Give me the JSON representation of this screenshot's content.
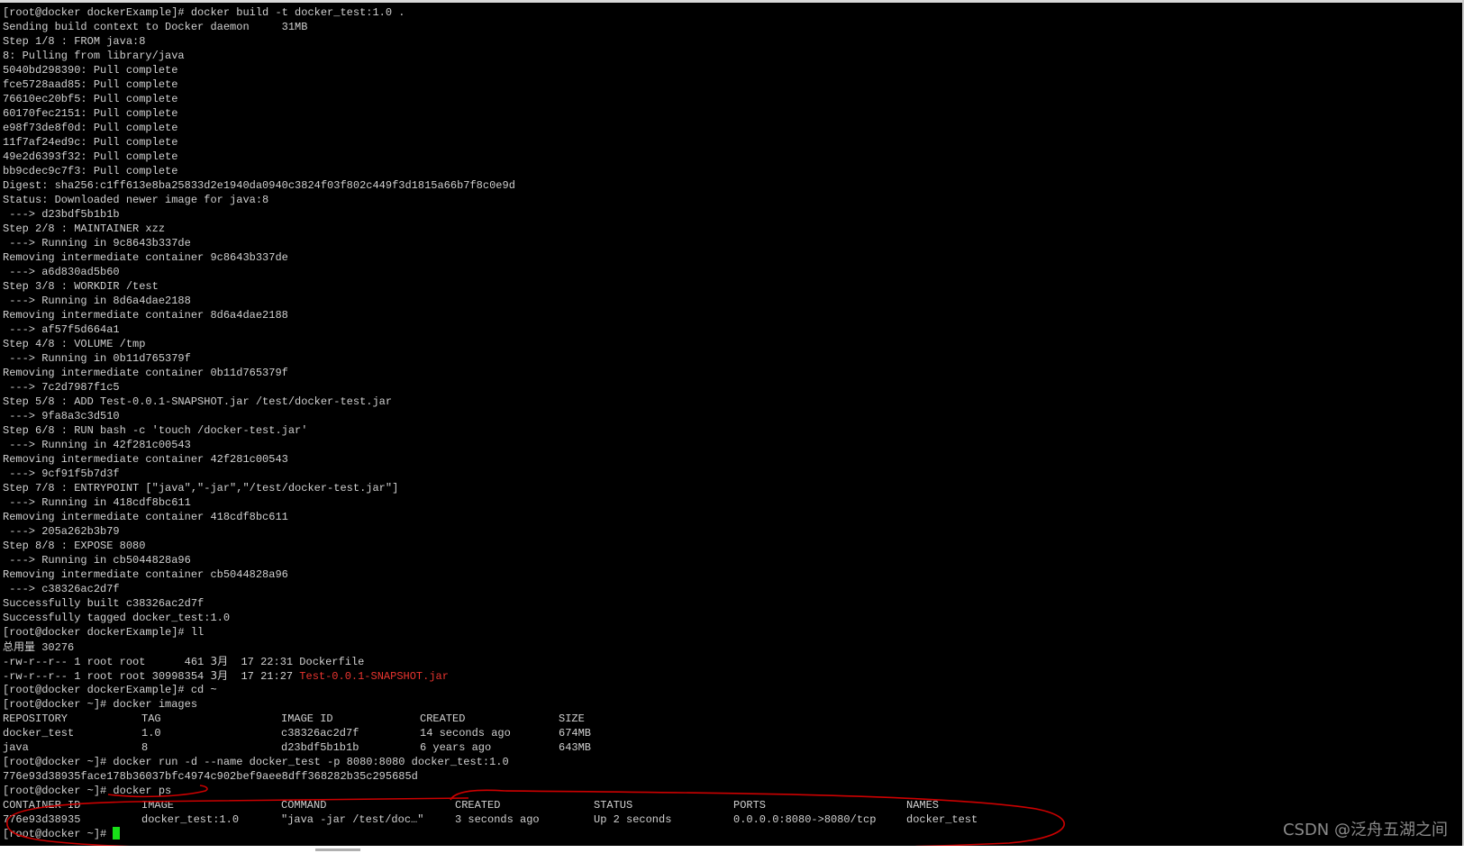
{
  "build": [
    "[root@docker dockerExample]# docker build -t docker_test:1.0 .",
    "Sending build context to Docker daemon     31MB",
    "Step 1/8 : FROM java:8",
    "8: Pulling from library/java",
    "5040bd298390: Pull complete",
    "fce5728aad85: Pull complete",
    "76610ec20bf5: Pull complete",
    "60170fec2151: Pull complete",
    "e98f73de8f0d: Pull complete",
    "11f7af24ed9c: Pull complete",
    "49e2d6393f32: Pull complete",
    "bb9cdec9c7f3: Pull complete",
    "Digest: sha256:c1ff613e8ba25833d2e1940da0940c3824f03f802c449f3d1815a66b7f8c0e9d",
    "Status: Downloaded newer image for java:8",
    " ---> d23bdf5b1b1b",
    "Step 2/8 : MAINTAINER xzz",
    " ---> Running in 9c8643b337de",
    "Removing intermediate container 9c8643b337de",
    " ---> a6d830ad5b60",
    "Step 3/8 : WORKDIR /test",
    " ---> Running in 8d6a4dae2188",
    "Removing intermediate container 8d6a4dae2188",
    " ---> af57f5d664a1",
    "Step 4/8 : VOLUME /tmp",
    " ---> Running in 0b11d765379f",
    "Removing intermediate container 0b11d765379f",
    " ---> 7c2d7987f1c5",
    "Step 5/8 : ADD Test-0.0.1-SNAPSHOT.jar /test/docker-test.jar",
    " ---> 9fa8a3c3d510",
    "Step 6/8 : RUN bash -c 'touch /docker-test.jar'",
    " ---> Running in 42f281c00543",
    "Removing intermediate container 42f281c00543",
    " ---> 9cf91f5b7d3f",
    "Step 7/8 : ENTRYPOINT [\"java\",\"-jar\",\"/test/docker-test.jar\"]",
    " ---> Running in 418cdf8bc611",
    "Removing intermediate container 418cdf8bc611",
    " ---> 205a262b3b79",
    "Step 8/8 : EXPOSE 8080",
    " ---> Running in cb5044828a96",
    "Removing intermediate container cb5044828a96",
    " ---> c38326ac2d7f",
    "Successfully built c38326ac2d7f",
    "Successfully tagged docker_test:1.0",
    "[root@docker dockerExample]# ll"
  ],
  "ll": {
    "total_label": "总用量",
    "total_value": " 30276",
    "files": [
      {
        "perms_size": "-rw-r--r-- 1 root root      461 ",
        "month": "3月",
        "date": "  17 22:31 ",
        "name": "Dockerfile",
        "red": false
      },
      {
        "perms_size": "-rw-r--r-- 1 root root 30998354 ",
        "month": "3月",
        "date": "  17 21:27 ",
        "name": "Test-0.0.1-SNAPSHOT.jar",
        "red": true
      }
    ]
  },
  "cmd_cd": "[root@docker dockerExample]# cd ~",
  "cmd_images": "[root@docker ~]# docker images",
  "images_table": {
    "headers": [
      "REPOSITORY",
      "TAG",
      "IMAGE ID",
      "CREATED",
      "SIZE"
    ],
    "rows": [
      [
        "docker_test",
        "1.0",
        "c38326ac2d7f",
        "14 seconds ago",
        "674MB"
      ],
      [
        "java",
        "8",
        "d23bdf5b1b1b",
        "6 years ago",
        "643MB"
      ]
    ]
  },
  "cmd_run": "[root@docker ~]# docker run -d --name docker_test -p 8080:8080 docker_test:1.0",
  "run_output": "776e93d38935face178b36037bfc4974c902bef9aee8dff368282b35c295685d",
  "cmd_ps": "[root@docker ~]# docker ps",
  "ps_table": {
    "headers": [
      "CONTAINER ID",
      "IMAGE",
      "COMMAND",
      "CREATED",
      "STATUS",
      "PORTS",
      "NAMES"
    ],
    "rows": [
      [
        "776e93d38935",
        "docker_test:1.0",
        "\"java -jar /test/doc…\"",
        "3 seconds ago",
        "Up 2 seconds",
        "0.0.0.0:8080->8080/tcp",
        "docker_test"
      ]
    ]
  },
  "final_prompt": "[root@docker ~]# ",
  "watermark": "CSDN @泛舟五湖之间",
  "colors": {
    "background": "#000000",
    "text": "#d0d0d0",
    "highlight_red": "#e8342f",
    "cursor": "#18e018",
    "annotation": "#cc0000"
  }
}
